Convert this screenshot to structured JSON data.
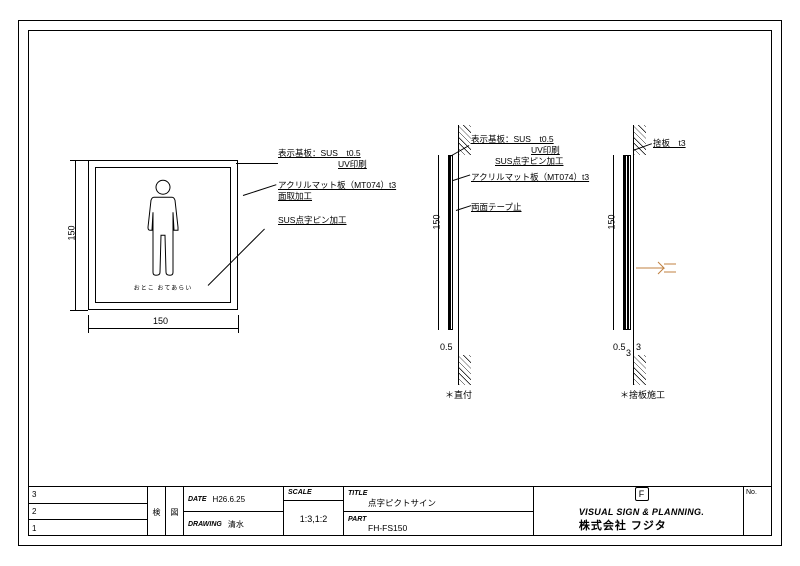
{
  "drawing": {
    "dim_width": "150",
    "dim_height": "150",
    "dim_t05": "0.5",
    "dim_t05b": "0.5",
    "dim_t3a": "3",
    "dim_t3b": "3",
    "sec_dim_h1": "150",
    "sec_dim_h2": "150"
  },
  "callouts": {
    "c1a": "表示基板：SUS　t0.5",
    "c1b": "UV印刷",
    "c2a": "アクリルマット板（MT074）t3",
    "c2b": "面取加工",
    "c3": "SUS点字ピン加工",
    "s1a": "表示基板：SUS　t0.5",
    "s1b": "UV印刷",
    "s1c": "SUS点字ピン加工",
    "s2": "アクリルマット板（MT074）t3",
    "s3": "両面テープ止",
    "s4": "捨板　t3"
  },
  "captions": {
    "cap_a": "＊直付",
    "cap_b": "＊捨板施工"
  },
  "braille": "おとこ おてあらい",
  "titleblock": {
    "rev1": "3",
    "rev2": "2",
    "rev3": "1",
    "app1": "検",
    "app2": "図",
    "date_lbl": "DATE",
    "date_val": "H26.6.25",
    "drawing_lbl": "DRAWING",
    "drawing_val": "清水",
    "scale_lbl": "SCALE",
    "scale_val": "1:3,1:2",
    "title_lbl": "TITLE",
    "title_val": "点字ピクトサイン",
    "part_lbl": "PART",
    "part_val": "FH-FS150",
    "company_tag": "VISUAL SIGN & PLANNING.",
    "company_name": "株式会社 フジタ",
    "logo": "F",
    "no_lbl": "No."
  }
}
